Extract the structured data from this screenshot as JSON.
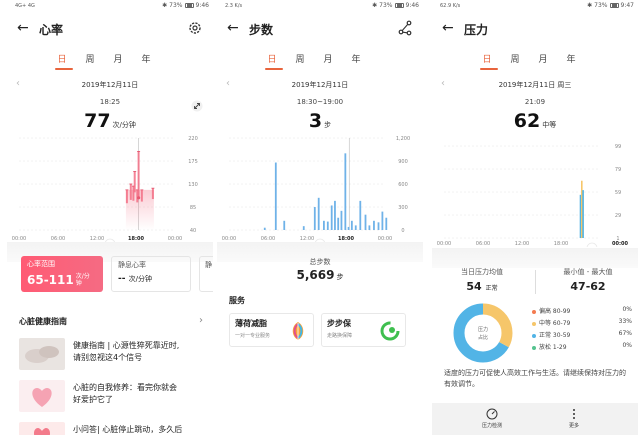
{
  "status": {
    "screen1": {
      "signal": "4G+ 4G",
      "battery": "73%",
      "time": "9:46"
    },
    "screen2": {
      "signal": "2.3 K/s",
      "battery": "73%",
      "time": "9:46"
    },
    "screen3": {
      "signal": "62.9 K/s",
      "battery": "73%",
      "time": "9:47"
    }
  },
  "tabs": [
    "日",
    "周",
    "月",
    "年"
  ],
  "heart": {
    "title": "心率",
    "date": "2019年12月11日",
    "time": "18:25",
    "value": "77",
    "unit": "次/分钟",
    "range_label": "心率范围",
    "range_value": "65-111",
    "range_unit_1": "次/分",
    "range_unit_2": "钟",
    "rest_label": "静息心率",
    "rest_value": "--",
    "rest_unit": "次/分钟",
    "partial_label": "静",
    "guide_title": "心脏健康指南",
    "guide_arrow": "›",
    "articles": [
      {
        "line1": "健康指南 | 心源性猝死靠近时,",
        "line2": "请别忽视这4个信号"
      },
      {
        "line1": "心脏的自我修养：看完你就会",
        "line2": "好爱护它了"
      },
      {
        "line1": "小问答| 心脏停止跳动，多久后",
        "line2": ""
      }
    ]
  },
  "steps": {
    "title": "步数",
    "date": "2019年12月11日",
    "time": "18:30~19:00",
    "value": "3",
    "unit": "步",
    "total_label": "总步数",
    "total_value": "5,669",
    "total_unit": "步",
    "service_title": "服务",
    "services": [
      {
        "name": "薄荷减脂",
        "desc": "一对一专业服务"
      },
      {
        "name": "步步保",
        "desc": "走路换保障"
      }
    ]
  },
  "stress": {
    "title": "压力",
    "date": "2019年12月11日 周三",
    "time": "21:09",
    "value": "62",
    "unit": "中等",
    "avg_label": "当日压力均值",
    "avg_value": "54",
    "avg_unit": "正常",
    "minmax_label": "最小值 - 最大值",
    "minmax_value": "47-62",
    "donut_center_1": "压力",
    "donut_center_2": "占比",
    "legend": [
      {
        "label": "偏高 80-99",
        "pct": "0%",
        "color": "#f47b50"
      },
      {
        "label": "中等 60-79",
        "pct": "33%",
        "color": "#f6c66a"
      },
      {
        "label": "正常 30-59",
        "pct": "67%",
        "color": "#52b4e6"
      },
      {
        "label": "放松 1-29",
        "pct": "0%",
        "color": "#55c38f"
      }
    ],
    "note": "适度的压力可促使人高效工作与生活。请继续保持对压力的有效调节。",
    "bottom": [
      {
        "label": "压力检测"
      },
      {
        "label": "更多"
      }
    ]
  },
  "chart_data": [
    {
      "type": "bar",
      "title": "",
      "x_ticks": [
        "00:00",
        "06:00",
        "12:00",
        "18:00",
        "00:00"
      ],
      "y_ticks": [
        220,
        175,
        130,
        85,
        40
      ],
      "ylim": [
        0,
        220
      ],
      "series": [
        {
          "values": [
            [
              16.6,
              64,
              96
            ],
            [
              17.2,
              72,
              110
            ],
            [
              17.6,
              70,
              105
            ],
            [
              17.8,
              90,
              140
            ],
            [
              18.2,
              66,
              96
            ],
            [
              18.4,
              77,
              188
            ],
            [
              18.9,
              68,
              96
            ],
            [
              20.6,
              74,
              100
            ]
          ]
        }
      ]
    },
    {
      "type": "bar",
      "title": "",
      "x_ticks": [
        "00:00",
        "06:00",
        "12:00",
        "18:00",
        "00:00"
      ],
      "y_ticks": [
        "1,200",
        "900",
        "600",
        "300",
        "0"
      ],
      "ylim": [
        0,
        1200
      ],
      "series": [
        {
          "values": [
            [
              5.5,
              30
            ],
            [
              7.2,
              880
            ],
            [
              8.5,
              120
            ],
            [
              11.5,
              50
            ],
            [
              13.2,
              300
            ],
            [
              13.8,
              420
            ],
            [
              14.6,
              120
            ],
            [
              15.2,
              110
            ],
            [
              15.8,
              320
            ],
            [
              16.3,
              380
            ],
            [
              16.8,
              160
            ],
            [
              17.3,
              250
            ],
            [
              17.9,
              1000
            ],
            [
              18.4,
              40
            ],
            [
              18.9,
              120
            ],
            [
              19.5,
              60
            ],
            [
              20.2,
              380
            ],
            [
              21.0,
              200
            ],
            [
              21.6,
              60
            ],
            [
              22.3,
              120
            ],
            [
              23.0,
              100
            ],
            [
              23.6,
              240
            ],
            [
              24.2,
              160
            ]
          ]
        }
      ]
    },
    {
      "type": "bar",
      "title": "",
      "x_ticks": [
        "00:00",
        "06:00",
        "12:00",
        "18:00",
        "00:00"
      ],
      "y_ticks": [
        99,
        79,
        59,
        29,
        1
      ],
      "ylim": [
        1,
        99
      ],
      "series": [
        {
          "values": [
            [
              21.0,
              47
            ],
            [
              21.2,
              62
            ],
            [
              21.4,
              52
            ]
          ]
        }
      ]
    }
  ]
}
